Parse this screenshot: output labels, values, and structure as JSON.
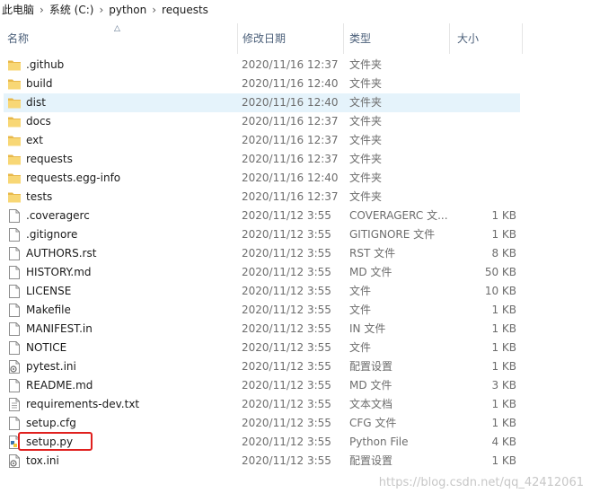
{
  "breadcrumb": {
    "items": [
      "此电脑",
      "系统 (C:)",
      "python",
      "requests"
    ],
    "separator": "›"
  },
  "columns": {
    "name": "名称",
    "date": "修改日期",
    "type": "类型",
    "size": "大小"
  },
  "files": [
    {
      "name": ".github",
      "date": "2020/11/16 12:37",
      "type": "文件夹",
      "size": "",
      "kind": "folder"
    },
    {
      "name": "build",
      "date": "2020/11/16 12:40",
      "type": "文件夹",
      "size": "",
      "kind": "folder"
    },
    {
      "name": "dist",
      "date": "2020/11/16 12:40",
      "type": "文件夹",
      "size": "",
      "kind": "folder",
      "selected": true
    },
    {
      "name": "docs",
      "date": "2020/11/16 12:37",
      "type": "文件夹",
      "size": "",
      "kind": "folder"
    },
    {
      "name": "ext",
      "date": "2020/11/16 12:37",
      "type": "文件夹",
      "size": "",
      "kind": "folder"
    },
    {
      "name": "requests",
      "date": "2020/11/16 12:37",
      "type": "文件夹",
      "size": "",
      "kind": "folder"
    },
    {
      "name": "requests.egg-info",
      "date": "2020/11/16 12:40",
      "type": "文件夹",
      "size": "",
      "kind": "folder"
    },
    {
      "name": "tests",
      "date": "2020/11/16 12:37",
      "type": "文件夹",
      "size": "",
      "kind": "folder"
    },
    {
      "name": ".coveragerc",
      "date": "2020/11/12 3:55",
      "type": "COVERAGERC 文...",
      "size": "1 KB",
      "kind": "file"
    },
    {
      "name": ".gitignore",
      "date": "2020/11/12 3:55",
      "type": "GITIGNORE 文件",
      "size": "1 KB",
      "kind": "file"
    },
    {
      "name": "AUTHORS.rst",
      "date": "2020/11/12 3:55",
      "type": "RST 文件",
      "size": "8 KB",
      "kind": "file"
    },
    {
      "name": "HISTORY.md",
      "date": "2020/11/12 3:55",
      "type": "MD 文件",
      "size": "50 KB",
      "kind": "file"
    },
    {
      "name": "LICENSE",
      "date": "2020/11/12 3:55",
      "type": "文件",
      "size": "10 KB",
      "kind": "file"
    },
    {
      "name": "Makefile",
      "date": "2020/11/12 3:55",
      "type": "文件",
      "size": "1 KB",
      "kind": "file"
    },
    {
      "name": "MANIFEST.in",
      "date": "2020/11/12 3:55",
      "type": "IN 文件",
      "size": "1 KB",
      "kind": "file"
    },
    {
      "name": "NOTICE",
      "date": "2020/11/12 3:55",
      "type": "文件",
      "size": "1 KB",
      "kind": "file"
    },
    {
      "name": "pytest.ini",
      "date": "2020/11/12 3:55",
      "type": "配置设置",
      "size": "1 KB",
      "kind": "config"
    },
    {
      "name": "README.md",
      "date": "2020/11/12 3:55",
      "type": "MD 文件",
      "size": "3 KB",
      "kind": "file"
    },
    {
      "name": "requirements-dev.txt",
      "date": "2020/11/12 3:55",
      "type": "文本文档",
      "size": "1 KB",
      "kind": "text"
    },
    {
      "name": "setup.cfg",
      "date": "2020/11/12 3:55",
      "type": "CFG 文件",
      "size": "1 KB",
      "kind": "file"
    },
    {
      "name": "setup.py",
      "date": "2020/11/12 3:55",
      "type": "Python File",
      "size": "4 KB",
      "kind": "python",
      "highlighted": true
    },
    {
      "name": "tox.ini",
      "date": "2020/11/12 3:55",
      "type": "配置设置",
      "size": "1 KB",
      "kind": "config"
    }
  ],
  "watermark": "https://blog.csdn.net/qq_42412061",
  "colors": {
    "folder": "#f8d775",
    "folder_dark": "#e8b84a",
    "selection": "#e5f3fb",
    "highlight": "#e0201e",
    "header_text": "#4c607a"
  }
}
